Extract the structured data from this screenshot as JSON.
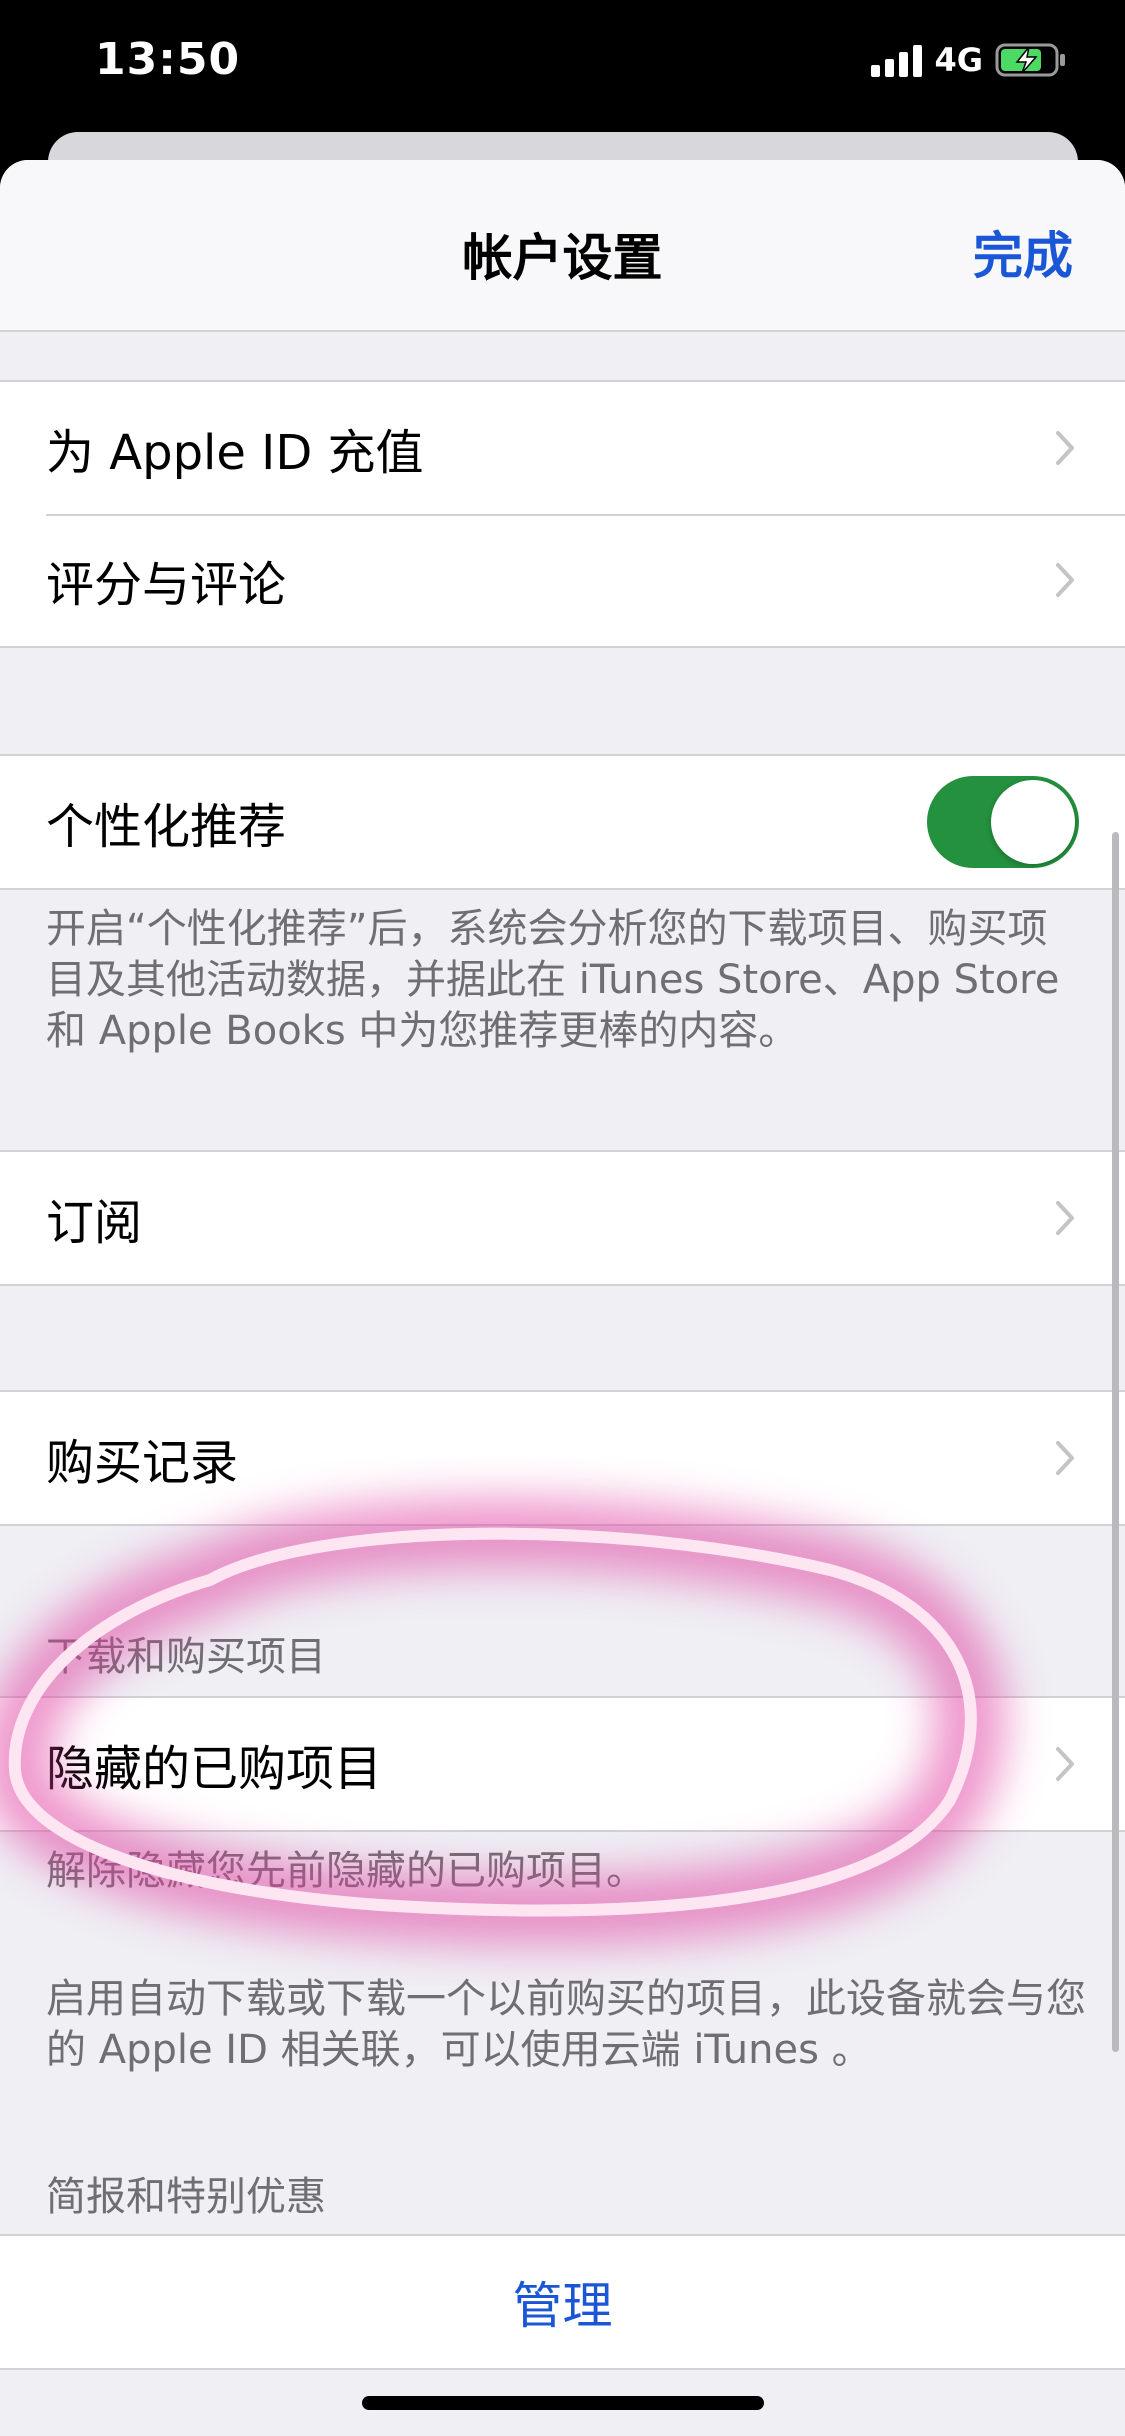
{
  "status_bar": {
    "time": "13:50",
    "network": "4G",
    "icons": [
      "signal-icon",
      "battery-charging-icon"
    ]
  },
  "nav": {
    "title": "帐户设置",
    "done_label": "完成"
  },
  "groups": {
    "top": {
      "items": [
        {
          "label": "为 Apple ID 充值",
          "icon": "chevron-right-icon"
        },
        {
          "label": "评分与评论",
          "icon": "chevron-right-icon"
        }
      ]
    },
    "personalization": {
      "label": "个性化推荐",
      "toggle_on": true,
      "note": "开启“个性化推荐”后，系统会分析您的下载项目、购买项目及其他活动数据，并据此在 iTunes Store、App Store 和 Apple Books 中为您推荐更棒的内容。"
    },
    "subscriptions": {
      "label": "订阅"
    },
    "purchase_history": {
      "label": "购买记录"
    },
    "downloads": {
      "header": "下载和购买项目",
      "hidden_label": "隐藏的已购项目",
      "hidden_note": "解除隐藏您先前隐藏的已购项目。",
      "auto_note": "启用自动下载或下载一个以前购买的项目，此设备就会与您的 Apple ID 相关联，可以使用云端 iTunes 。"
    },
    "newsletters": {
      "header": "简报和特别优惠",
      "manage_label": "管理"
    }
  },
  "colors": {
    "accent": "#1a56d6",
    "toggle_on": "#23913e",
    "annotation": "#e040a0"
  }
}
